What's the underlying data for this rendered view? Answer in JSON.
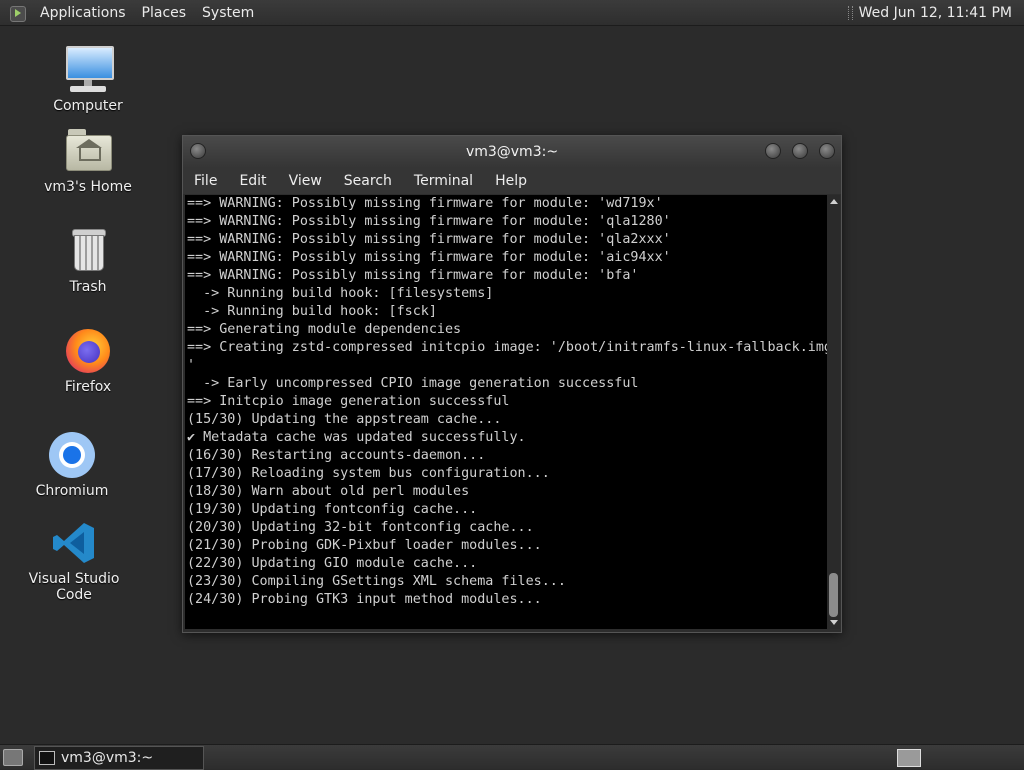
{
  "top_panel": {
    "menus": [
      "Applications",
      "Places",
      "System"
    ],
    "clock": "Wed Jun 12, 11:41 PM"
  },
  "desktop_icons": [
    {
      "label": "Computer",
      "icon": "computer-icon"
    },
    {
      "label": "vm3's Home",
      "icon": "home-folder-icon"
    },
    {
      "label": "Trash",
      "icon": "trash-icon"
    },
    {
      "label": "Firefox",
      "icon": "firefox-icon"
    },
    {
      "label": "Chromium",
      "icon": "chromium-icon"
    },
    {
      "label": "Visual Studio Code",
      "icon": "vscode-icon"
    }
  ],
  "terminal_window": {
    "title": "vm3@vm3:~",
    "menus": [
      "File",
      "Edit",
      "View",
      "Search",
      "Terminal",
      "Help"
    ],
    "lines": [
      "==> WARNING: Possibly missing firmware for module: 'wd719x'",
      "==> WARNING: Possibly missing firmware for module: 'qla1280'",
      "==> WARNING: Possibly missing firmware for module: 'qla2xxx'",
      "==> WARNING: Possibly missing firmware for module: 'aic94xx'",
      "==> WARNING: Possibly missing firmware for module: 'bfa'",
      "  -> Running build hook: [filesystems]",
      "  -> Running build hook: [fsck]",
      "==> Generating module dependencies",
      "==> Creating zstd-compressed initcpio image: '/boot/initramfs-linux-fallback.img",
      "'",
      "  -> Early uncompressed CPIO image generation successful",
      "==> Initcpio image generation successful",
      "(15/30) Updating the appstream cache...",
      "✔ Metadata cache was updated successfully.",
      "(16/30) Restarting accounts-daemon...",
      "(17/30) Reloading system bus configuration...",
      "(18/30) Warn about old perl modules",
      "(19/30) Updating fontconfig cache...",
      "(20/30) Updating 32-bit fontconfig cache...",
      "(21/30) Probing GDK-Pixbuf loader modules...",
      "(22/30) Updating GIO module cache...",
      "(23/30) Compiling GSettings XML schema files...",
      "(24/30) Probing GTK3 input method modules..."
    ]
  },
  "taskbar": {
    "window_button": "vm3@vm3:~"
  },
  "colors": {
    "desktop_bg": "#2b2b2b",
    "terminal_bg": "#000000",
    "terminal_fg": "#d0d0d0"
  }
}
